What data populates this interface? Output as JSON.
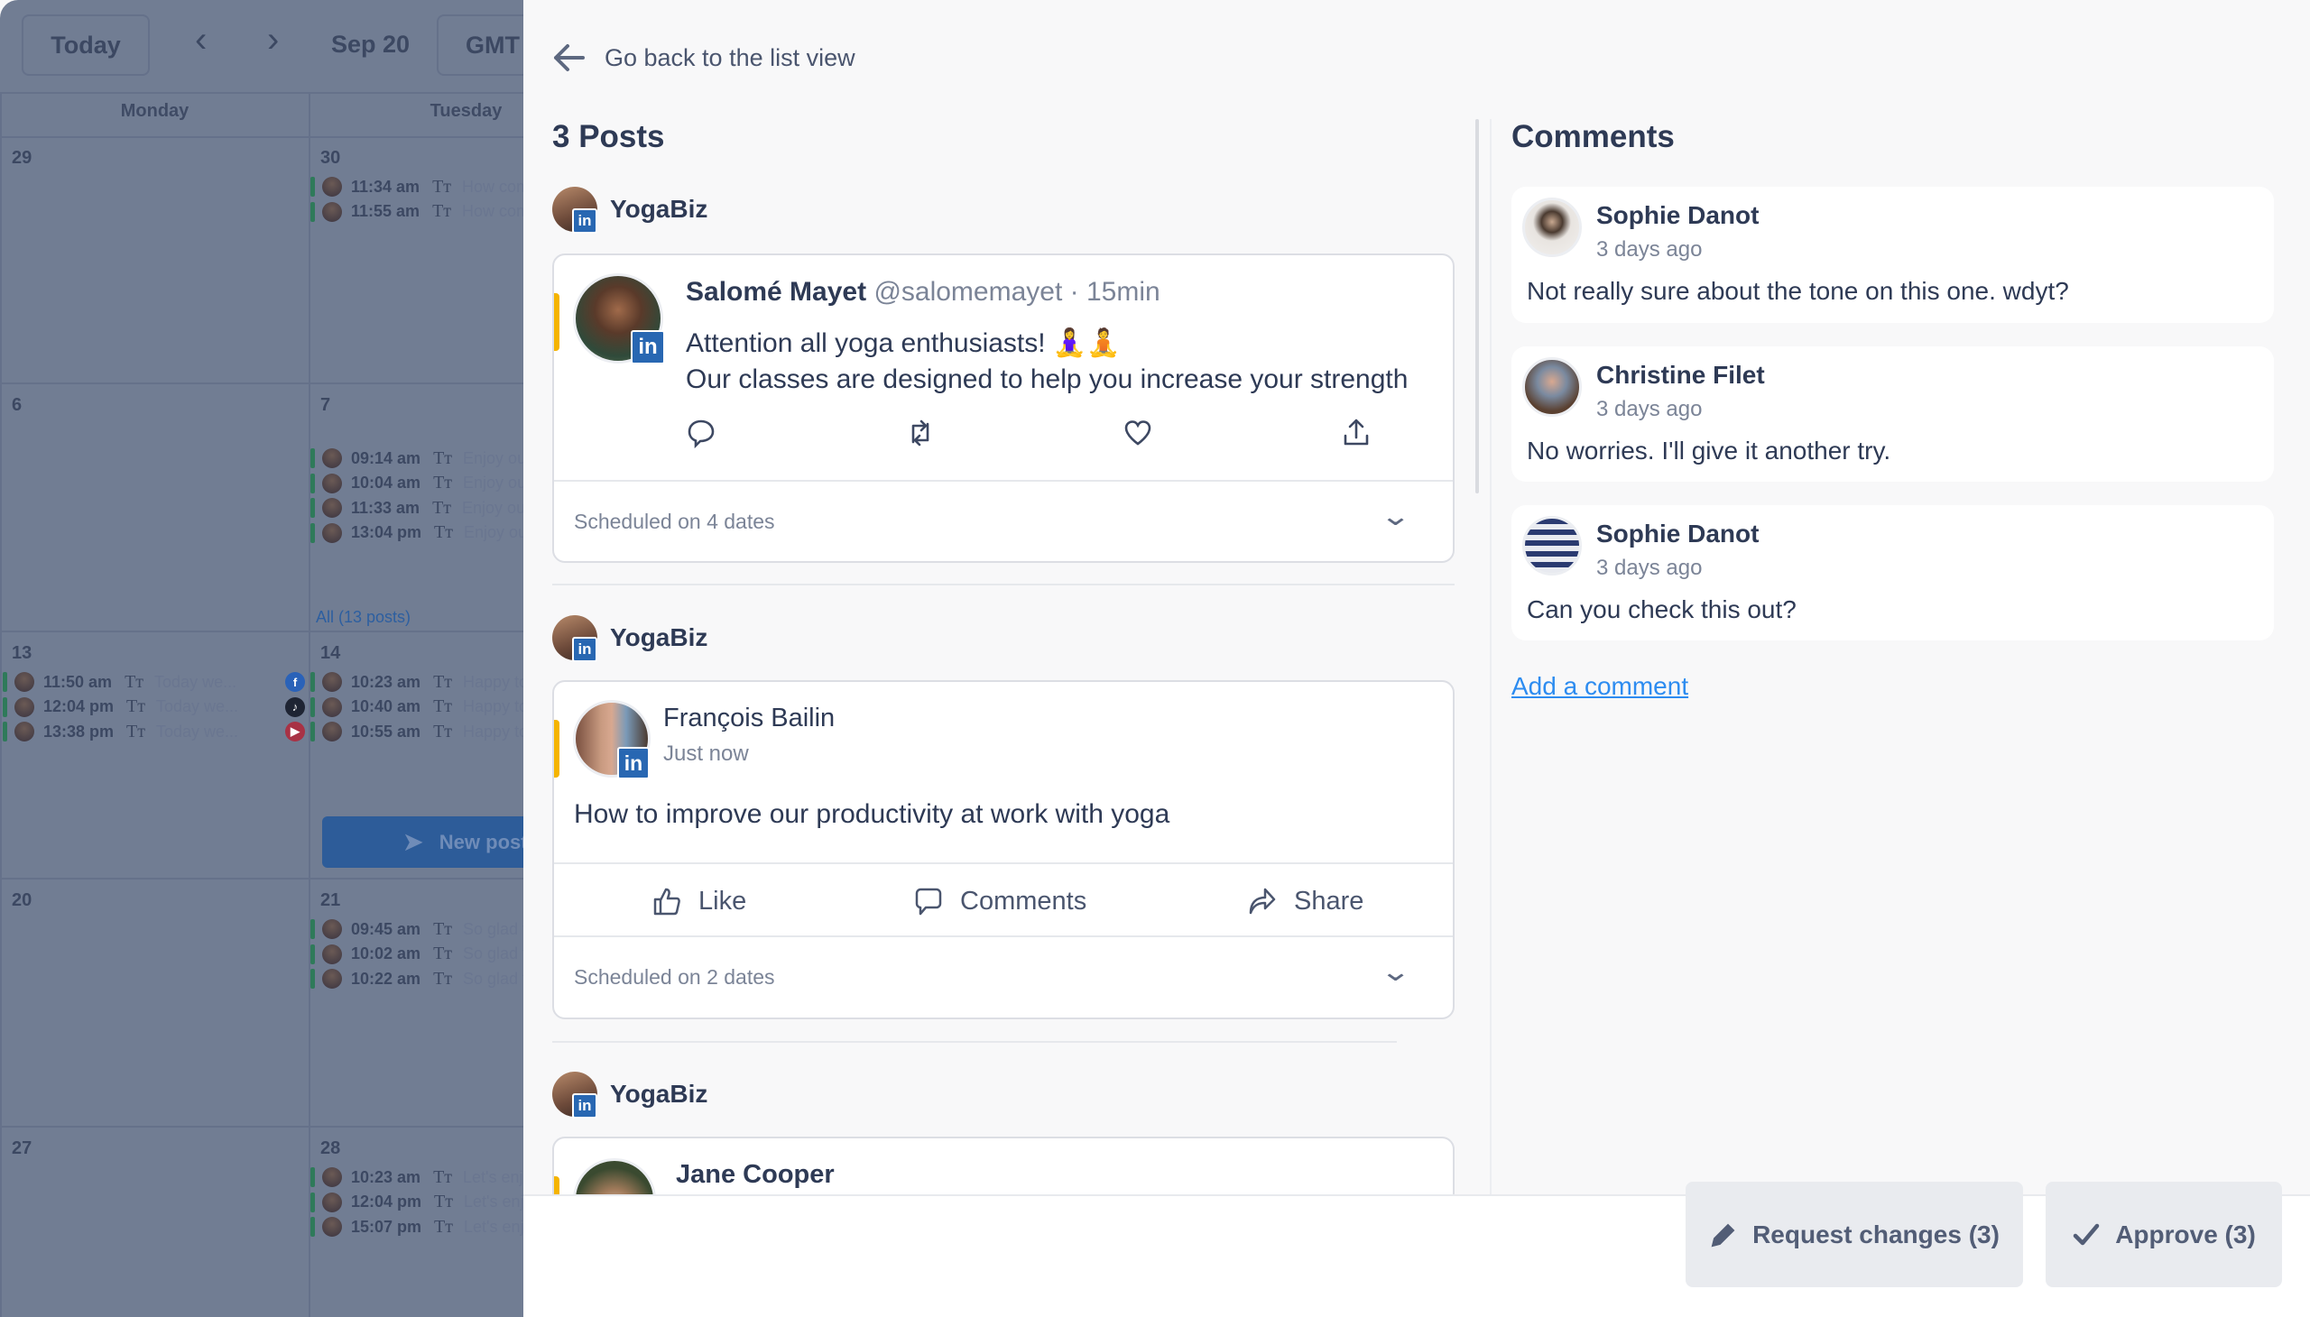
{
  "calendar": {
    "today_label": "Today",
    "prev_icon": "chevron-left-icon",
    "next_icon": "chevron-right-icon",
    "current_date": "Sep 20",
    "timezone_label": "GMT",
    "weekdays": [
      "Monday",
      "Tuesday"
    ],
    "weeks": [
      {
        "mon": "29",
        "tue": "30"
      },
      {
        "mon": "6",
        "tue": "7"
      },
      {
        "mon": "13",
        "tue": "14"
      },
      {
        "mon": "20",
        "tue": "21"
      },
      {
        "mon": "27",
        "tue": "28"
      }
    ],
    "events": [
      {
        "week": 0,
        "col": "tue",
        "time": "11:34 am",
        "snippet": "How com"
      },
      {
        "week": 0,
        "col": "tue",
        "time": "11:55 am",
        "snippet": "How com"
      },
      {
        "week": 1,
        "col": "tue",
        "time": "09:14 am",
        "snippet": "Enjoy our"
      },
      {
        "week": 1,
        "col": "tue",
        "time": "10:04 am",
        "snippet": "Enjoy our"
      },
      {
        "week": 1,
        "col": "tue",
        "time": "11:33 am",
        "snippet": "Enjoy our"
      },
      {
        "week": 1,
        "col": "tue",
        "time": "13:04 pm",
        "snippet": "Enjoy our"
      },
      {
        "week": 2,
        "col": "mon",
        "time": "11:50 am",
        "snippet": "Today we...",
        "platform": "facebook"
      },
      {
        "week": 2,
        "col": "mon",
        "time": "12:04 pm",
        "snippet": "Today we...",
        "platform": "tiktok"
      },
      {
        "week": 2,
        "col": "mon",
        "time": "13:38 pm",
        "snippet": "Today we...",
        "platform": "youtube"
      },
      {
        "week": 2,
        "col": "tue",
        "time": "10:23 am",
        "snippet": "Happy to"
      },
      {
        "week": 2,
        "col": "tue",
        "time": "10:40 am",
        "snippet": "Happy to"
      },
      {
        "week": 2,
        "col": "tue",
        "time": "10:55 am",
        "snippet": "Happy to"
      },
      {
        "week": 3,
        "col": "tue",
        "time": "09:45 am",
        "snippet": "So glad t"
      },
      {
        "week": 3,
        "col": "tue",
        "time": "10:02 am",
        "snippet": "So glad t"
      },
      {
        "week": 3,
        "col": "tue",
        "time": "10:22 am",
        "snippet": "So glad t"
      },
      {
        "week": 4,
        "col": "tue",
        "time": "10:23 am",
        "snippet": "Let's enj"
      },
      {
        "week": 4,
        "col": "tue",
        "time": "12:04 pm",
        "snippet": "Let's enj"
      },
      {
        "week": 4,
        "col": "tue",
        "time": "15:07 pm",
        "snippet": "Let's enj"
      }
    ],
    "all_posts_link": "All (13 posts)",
    "new_post_label": "New post"
  },
  "header": {
    "back_label": "Go back to the list view",
    "back_icon": "arrow-left-icon"
  },
  "posts": {
    "title": "3 Posts",
    "items": [
      {
        "account": "YogaBiz",
        "network": "linkedin",
        "author": "Salomé Mayet",
        "handle": "@salomemayet · 15min",
        "lines": [
          "Attention all yoga enthusiasts! 🧘‍♀️🧘",
          "Our classes are designed to help you increase your strength"
        ],
        "actions": [
          "reply-icon",
          "retweet-icon",
          "heart-icon",
          "share-upload-icon"
        ],
        "scheduled": "Scheduled on 4 dates"
      },
      {
        "account": "YogaBiz",
        "network": "linkedin",
        "author": "François Bailin",
        "time": "Just now",
        "text": "How to improve our productivity at work with yoga",
        "actions": [
          {
            "label": "Like",
            "icon": "thumbs-up-icon"
          },
          {
            "label": "Comments",
            "icon": "comment-icon"
          },
          {
            "label": "Share",
            "icon": "share-arrow-icon"
          }
        ],
        "scheduled": "Scheduled on 2 dates"
      },
      {
        "account": "YogaBiz",
        "network": "linkedin",
        "author": "Jane Cooper"
      }
    ]
  },
  "comments": {
    "title": "Comments",
    "items": [
      {
        "name": "Sophie Danot",
        "time": "3 days ago",
        "text": "Not really sure about the tone on this one. wdyt?"
      },
      {
        "name": "Christine Filet",
        "time": "3 days ago",
        "text": "No worries. I'll give it another try."
      },
      {
        "name": "Sophie Danot",
        "time": "3 days ago",
        "text": "Can you check this out?"
      }
    ],
    "add_label": "Add a comment"
  },
  "footer": {
    "request_changes_label": "Request changes (3)",
    "approve_label": "Approve (3)"
  },
  "colors": {
    "accent_yellow": "#f5b400",
    "link_blue": "#2d8cf0",
    "linkedin": "#2867b2",
    "overlay": "#717d93"
  }
}
